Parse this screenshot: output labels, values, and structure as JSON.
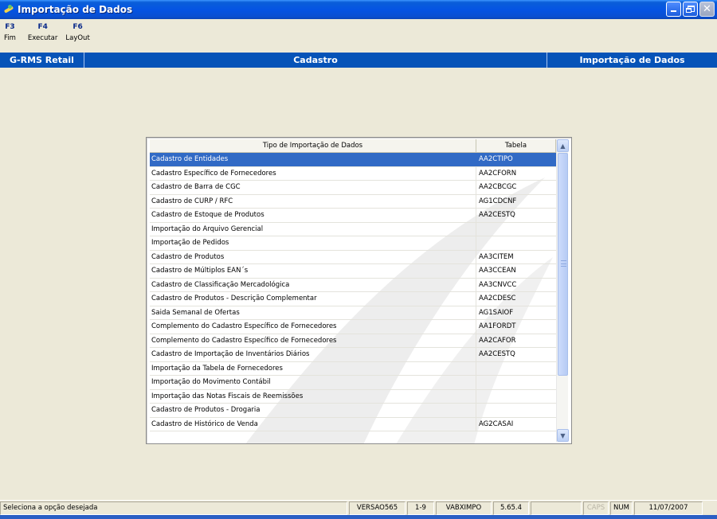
{
  "window": {
    "title": "Importação de Dados"
  },
  "toolbar": [
    {
      "key": "F3",
      "label": "Fim"
    },
    {
      "key": "F4",
      "label": "Executar"
    },
    {
      "key": "F6",
      "label": "LayOut"
    }
  ],
  "modulebar": {
    "system": "G-RMS Retail",
    "module": "Cadastro",
    "screen": "Importação de Dados"
  },
  "grid": {
    "columns": [
      "Tipo de Importação de Dados",
      "Tabela"
    ],
    "selected_index": 0,
    "rows": [
      [
        "Cadastro de Entidades",
        "AA2CTIPO"
      ],
      [
        "Cadastro Específico de Fornecedores",
        "AA2CFORN"
      ],
      [
        "Cadastro de Barra de CGC",
        "AA2CBCGC"
      ],
      [
        "Cadastro de CURP / RFC",
        "AG1CDCNF"
      ],
      [
        "Cadastro de Estoque de Produtos",
        "AA2CESTQ"
      ],
      [
        "Importação do Arquivo Gerencial",
        ""
      ],
      [
        "Importação de Pedidos",
        ""
      ],
      [
        "Cadastro de Produtos",
        "AA3CITEM"
      ],
      [
        "Cadastro de Múltiplos EAN´s",
        "AA3CCEAN"
      ],
      [
        "Cadastro de Classificação Mercadológica",
        "AA3CNVCC"
      ],
      [
        "Cadastro de Produtos - Descrição Complementar",
        "AA2CDESC"
      ],
      [
        "Saida Semanal de Ofertas",
        "AG1SAIOF"
      ],
      [
        "Complemento do Cadastro Específico de Fornecedores",
        "AA1FORDT"
      ],
      [
        "Complemento do Cadastro Específico de Fornecedores",
        "AA2CAFOR"
      ],
      [
        "Cadastro de Importação de Inventários Diários",
        "AA2CESTQ"
      ],
      [
        "Importação da Tabela de Fornecedores",
        ""
      ],
      [
        "Importação do Movimento Contábil",
        ""
      ],
      [
        "Importação das Notas Fiscais de Reemissões",
        ""
      ],
      [
        "Cadastro de Produtos - Drogaria",
        ""
      ],
      [
        "Cadastro de Histórico de Venda",
        "AG2CASAI"
      ]
    ]
  },
  "statusbar": {
    "message": "Seleciona a opção desejada",
    "version": "VERSAO565",
    "range": "1-9",
    "program": "VABXIMPO",
    "build": "5.65.4",
    "blank": "",
    "caps": "CAPS",
    "num": "NUM",
    "date": "11/07/2007"
  },
  "colors": {
    "titlebar": "#0554e3",
    "modulebar": "#0653b8",
    "selection": "#316ac5",
    "background": "#ece9d8"
  },
  "icons": {
    "app": "app-icon",
    "minimize": "minimize-icon",
    "maximize": "restore-icon",
    "close": "close-icon",
    "scroll_up": "scroll-up-icon",
    "scroll_down": "scroll-down-icon"
  }
}
